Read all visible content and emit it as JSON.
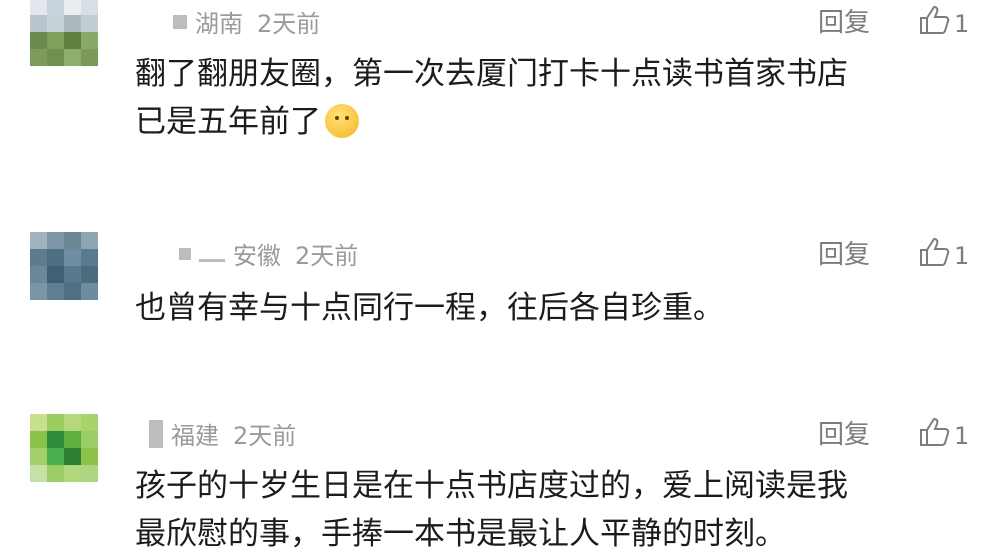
{
  "comments": [
    {
      "region": "湖南",
      "time": "2天前",
      "reply_label": "回复",
      "likes": "1",
      "lines": [
        "翻了翻朋友圈，第一次去厦门打卡十点读书首家书店",
        "已是五年前了"
      ],
      "emoji": "face-with-hand-over-mouth"
    },
    {
      "region": "安徽",
      "time": "2天前",
      "reply_label": "回复",
      "likes": "1",
      "lines": [
        "也曾有幸与十点同行一程，往后各自珍重。"
      ]
    },
    {
      "region": "福建",
      "time": "2天前",
      "reply_label": "回复",
      "likes": "1",
      "lines": [
        "孩子的十岁生日是在十点书店度过的，爱上阅读是我",
        "最欣慰的事，手捧一本书是最让人平静的时刻。"
      ]
    }
  ],
  "colors": {
    "avatar1": [
      "#e2e8ee",
      "#c9d3db",
      "#e8eef2",
      "#d7dfe6",
      "#b9c4cc",
      "#c7d1d8",
      "#aeb8bf",
      "#c2ccd3",
      "#6a8b4e",
      "#7ea15a",
      "#5d7f3f",
      "#8aa968",
      "#7e9b5b",
      "#6f9150",
      "#8fad6b",
      "#7b9958"
    ],
    "avatar2": [
      "#9fb3c0",
      "#7d97a6",
      "#6c8896",
      "#8ea6b4",
      "#5d7b8b",
      "#4f6e80",
      "#6f8ea1",
      "#5a7a8d",
      "#6a879a",
      "#3f6175",
      "#58798b",
      "#4c6b7d",
      "#7896a6",
      "#5f7f90",
      "#4f7083",
      "#6d8d9e"
    ],
    "avatar3": [
      "#c6e08c",
      "#9bcc60",
      "#b5d97a",
      "#a8d36c",
      "#8bc34a",
      "#2e8b3a",
      "#5faf3f",
      "#9ccc65",
      "#a2d06a",
      "#4caf50",
      "#2f7d32",
      "#8bc34a",
      "#c5e1a5",
      "#9ccc65",
      "#b2d67e",
      "#aed581"
    ]
  }
}
